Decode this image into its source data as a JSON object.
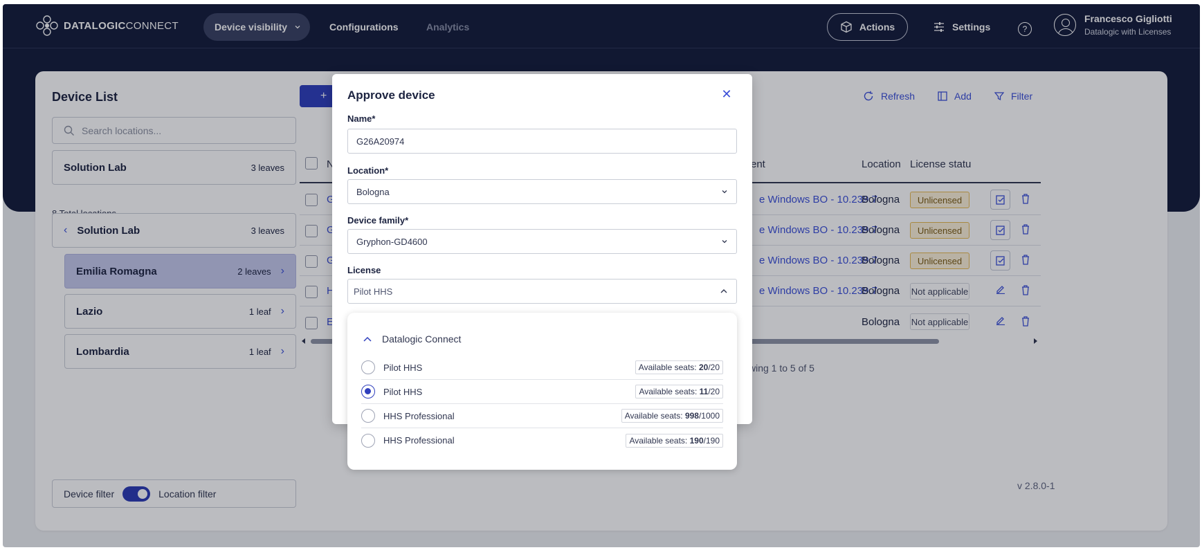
{
  "brand": {
    "name_bold": "DATALOGIC",
    "name_light": "CONNECT"
  },
  "nav": {
    "device_visibility": "Device visibility",
    "configurations": "Configurations",
    "analytics": "Analytics",
    "actions": "Actions",
    "settings": "Settings",
    "help": "?"
  },
  "user": {
    "name": "Francesco Gigliotti",
    "org": "Datalogic with Licenses"
  },
  "sidebar": {
    "title": "Device List",
    "search_placeholder": "Search locations...",
    "root": {
      "label": "Solution Lab",
      "leaves": "3 leaves"
    },
    "total": "8 Total locations",
    "current": {
      "label": "Solution Lab",
      "leaves": "3 leaves"
    },
    "children": [
      {
        "label": "Emilia Romagna",
        "leaves": "2 leaves"
      },
      {
        "label": "Lazio",
        "leaves": "1 leaf"
      },
      {
        "label": "Lombardia",
        "leaves": "1 leaf"
      }
    ],
    "filter": {
      "device": "Device filter",
      "location": "Location filter"
    }
  },
  "toolbar": {
    "add_primary": "+",
    "refresh": "Refresh",
    "add": "Add",
    "filter": "Filter"
  },
  "table": {
    "headers": {
      "name": "Na",
      "agent": "ent",
      "location": "Location",
      "license": "License status"
    },
    "rows": [
      {
        "name": "G2",
        "agent": "e Windows BO - 10.239.7",
        "location": "Bologna",
        "license": "Unlicensed"
      },
      {
        "name": "G2",
        "agent": "e Windows BO - 10.239.7",
        "location": "Bologna",
        "license": "Unlicensed"
      },
      {
        "name": "G2",
        "agent": "e Windows BO - 10.239.7",
        "location": "Bologna",
        "license": "Unlicensed"
      },
      {
        "name": "He",
        "agent": "e Windows BO - 10.239.7",
        "location": "Bologna",
        "license": "Not applicable"
      },
      {
        "name": "Ec",
        "agent": "",
        "location": "Bologna",
        "license": "Not applicable"
      }
    ],
    "paging": "wing 1 to 5 of 5"
  },
  "version": "v 2.8.0-1",
  "modal": {
    "title": "Approve device",
    "name_label": "Name*",
    "name_value": "G26A20974",
    "location_label": "Location*",
    "location_value": "Bologna",
    "family_label": "Device family*",
    "family_value": "Gryphon-GD4600",
    "license_label": "License",
    "license_value": "Pilot HHS"
  },
  "license_dropdown": {
    "group": "Datalogic Connect",
    "seats_prefix": "Available seats: ",
    "options": [
      {
        "label": "Pilot HHS",
        "available": "20",
        "total": "/20",
        "selected": false
      },
      {
        "label": "Pilot HHS",
        "available": "11",
        "total": "/20",
        "selected": true
      },
      {
        "label": "HHS Professional",
        "available": "998",
        "total": "/1000",
        "selected": false
      },
      {
        "label": "HHS Professional",
        "available": "190",
        "total": "/190",
        "selected": false
      }
    ]
  },
  "colors": {
    "navy": "#141c3b",
    "accent": "#2f3fbd",
    "link": "#3b4fd8",
    "selected_loc": "#c5c9ec",
    "warning": "#e7b94f"
  }
}
